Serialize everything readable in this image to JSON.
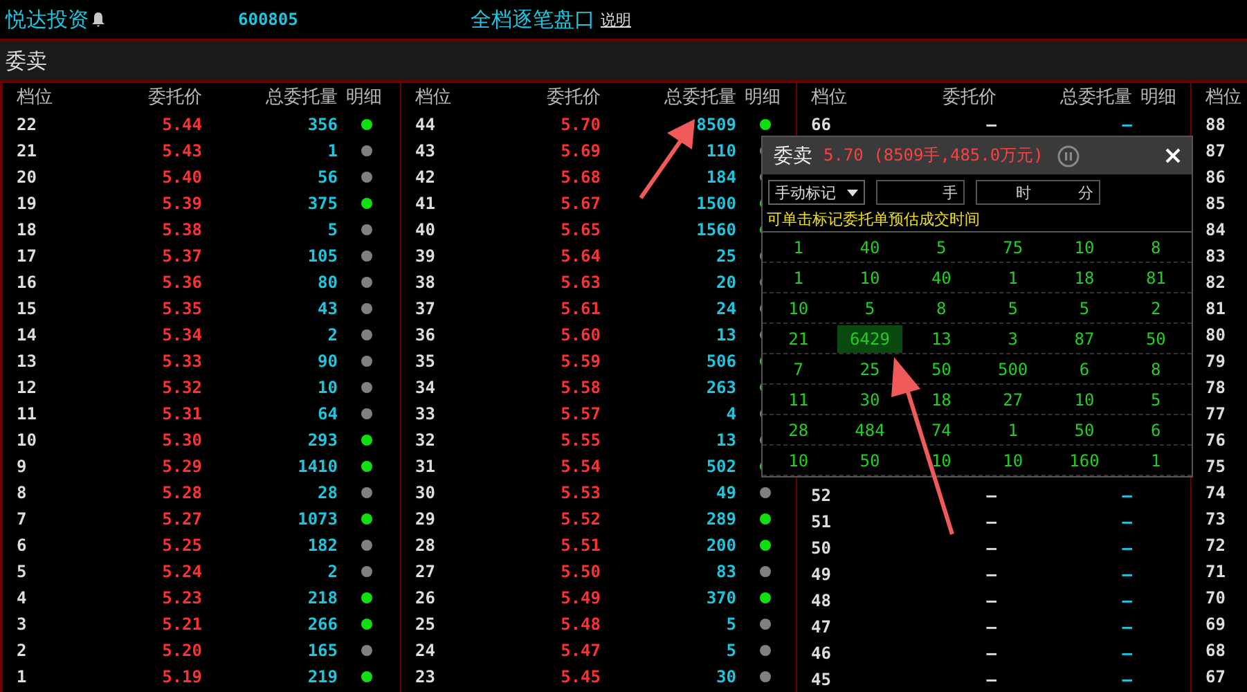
{
  "header": {
    "stock_name": "悦达投资",
    "code": "600805",
    "title": "全档逐笔盘口",
    "help_link": "说明"
  },
  "section_title": "委卖",
  "groups": [
    {
      "columns": [
        "档位",
        "委托价",
        "总委托量",
        "明细"
      ],
      "rows": [
        {
          "tier": "22",
          "price": "5.44",
          "volume": "356",
          "detail": true
        },
        {
          "tier": "21",
          "price": "5.43",
          "volume": "1",
          "detail": false
        },
        {
          "tier": "20",
          "price": "5.40",
          "volume": "56",
          "detail": false
        },
        {
          "tier": "19",
          "price": "5.39",
          "volume": "375",
          "detail": true
        },
        {
          "tier": "18",
          "price": "5.38",
          "volume": "5",
          "detail": false
        },
        {
          "tier": "17",
          "price": "5.37",
          "volume": "105",
          "detail": false
        },
        {
          "tier": "16",
          "price": "5.36",
          "volume": "80",
          "detail": false
        },
        {
          "tier": "15",
          "price": "5.35",
          "volume": "43",
          "detail": false
        },
        {
          "tier": "14",
          "price": "5.34",
          "volume": "2",
          "detail": false
        },
        {
          "tier": "13",
          "price": "5.33",
          "volume": "90",
          "detail": false
        },
        {
          "tier": "12",
          "price": "5.32",
          "volume": "10",
          "detail": false
        },
        {
          "tier": "11",
          "price": "5.31",
          "volume": "64",
          "detail": false
        },
        {
          "tier": "10",
          "price": "5.30",
          "volume": "293",
          "detail": true
        },
        {
          "tier": "9",
          "price": "5.29",
          "volume": "1410",
          "detail": true
        },
        {
          "tier": "8",
          "price": "5.28",
          "volume": "28",
          "detail": false
        },
        {
          "tier": "7",
          "price": "5.27",
          "volume": "1073",
          "detail": true
        },
        {
          "tier": "6",
          "price": "5.25",
          "volume": "182",
          "detail": false
        },
        {
          "tier": "5",
          "price": "5.24",
          "volume": "2",
          "detail": false
        },
        {
          "tier": "4",
          "price": "5.23",
          "volume": "218",
          "detail": true
        },
        {
          "tier": "3",
          "price": "5.21",
          "volume": "266",
          "detail": true
        },
        {
          "tier": "2",
          "price": "5.20",
          "volume": "165",
          "detail": false
        },
        {
          "tier": "1",
          "price": "5.19",
          "volume": "219",
          "detail": true
        }
      ]
    },
    {
      "columns": [
        "档位",
        "委托价",
        "总委托量",
        "明细"
      ],
      "rows": [
        {
          "tier": "44",
          "price": "5.70",
          "volume": "8509",
          "detail": true
        },
        {
          "tier": "43",
          "price": "5.69",
          "volume": "110",
          "detail": false
        },
        {
          "tier": "42",
          "price": "5.68",
          "volume": "184",
          "detail": false
        },
        {
          "tier": "41",
          "price": "5.67",
          "volume": "1500",
          "detail": true
        },
        {
          "tier": "40",
          "price": "5.65",
          "volume": "1560",
          "detail": true
        },
        {
          "tier": "39",
          "price": "5.64",
          "volume": "25",
          "detail": false
        },
        {
          "tier": "38",
          "price": "5.63",
          "volume": "20",
          "detail": false
        },
        {
          "tier": "37",
          "price": "5.61",
          "volume": "24",
          "detail": false
        },
        {
          "tier": "36",
          "price": "5.60",
          "volume": "13",
          "detail": false
        },
        {
          "tier": "35",
          "price": "5.59",
          "volume": "506",
          "detail": true
        },
        {
          "tier": "34",
          "price": "5.58",
          "volume": "263",
          "detail": true
        },
        {
          "tier": "33",
          "price": "5.57",
          "volume": "4",
          "detail": false
        },
        {
          "tier": "32",
          "price": "5.55",
          "volume": "13",
          "detail": false
        },
        {
          "tier": "31",
          "price": "5.54",
          "volume": "502",
          "detail": true
        },
        {
          "tier": "30",
          "price": "5.53",
          "volume": "49",
          "detail": false
        },
        {
          "tier": "29",
          "price": "5.52",
          "volume": "289",
          "detail": true
        },
        {
          "tier": "28",
          "price": "5.51",
          "volume": "200",
          "detail": true
        },
        {
          "tier": "27",
          "price": "5.50",
          "volume": "83",
          "detail": false
        },
        {
          "tier": "26",
          "price": "5.49",
          "volume": "370",
          "detail": true
        },
        {
          "tier": "25",
          "price": "5.48",
          "volume": "5",
          "detail": false
        },
        {
          "tier": "24",
          "price": "5.47",
          "volume": "5",
          "detail": false
        },
        {
          "tier": "23",
          "price": "5.45",
          "volume": "30",
          "detail": false
        }
      ]
    },
    {
      "columns": [
        "档位",
        "委托价",
        "总委托量",
        "明细"
      ],
      "rows": [
        {
          "tier": "66",
          "price": "—",
          "volume": "—"
        },
        {
          "tier": "52",
          "price": "—",
          "volume": "—"
        },
        {
          "tier": "51",
          "price": "—",
          "volume": "—"
        },
        {
          "tier": "50",
          "price": "—",
          "volume": "—"
        },
        {
          "tier": "49",
          "price": "—",
          "volume": "—"
        },
        {
          "tier": "48",
          "price": "—",
          "volume": "—"
        },
        {
          "tier": "47",
          "price": "—",
          "volume": "—"
        },
        {
          "tier": "46",
          "price": "—",
          "volume": "—"
        },
        {
          "tier": "45",
          "price": "—",
          "volume": "—"
        }
      ]
    },
    {
      "columns": [
        "档位"
      ],
      "rows": [
        {
          "tier": "88"
        },
        {
          "tier": "87"
        },
        {
          "tier": "86"
        },
        {
          "tier": "85"
        },
        {
          "tier": "84"
        },
        {
          "tier": "83"
        },
        {
          "tier": "82"
        },
        {
          "tier": "81"
        },
        {
          "tier": "80"
        },
        {
          "tier": "79"
        },
        {
          "tier": "78"
        },
        {
          "tier": "77"
        },
        {
          "tier": "76"
        },
        {
          "tier": "75"
        },
        {
          "tier": "74"
        },
        {
          "tier": "73"
        },
        {
          "tier": "72"
        },
        {
          "tier": "71"
        },
        {
          "tier": "70"
        },
        {
          "tier": "69"
        },
        {
          "tier": "68"
        },
        {
          "tier": "67"
        }
      ]
    }
  ],
  "popup": {
    "title": "委卖",
    "summary": "5.70 (8509手,485.0万元)",
    "mark_select": "手动标记",
    "lots_unit": "手",
    "hour_unit": "时",
    "minute_unit": "分",
    "hint": "可单击标记委托单预估成交时间",
    "grid": [
      [
        {
          "value": "1",
          "selected": false
        },
        {
          "value": "40",
          "selected": false
        },
        {
          "value": "5",
          "selected": false
        },
        {
          "value": "75",
          "selected": false
        },
        {
          "value": "10",
          "selected": false
        },
        {
          "value": "8",
          "selected": false
        }
      ],
      [
        {
          "value": "1",
          "selected": false
        },
        {
          "value": "10",
          "selected": false
        },
        {
          "value": "40",
          "selected": false
        },
        {
          "value": "1",
          "selected": false
        },
        {
          "value": "18",
          "selected": false
        },
        {
          "value": "81",
          "selected": false
        }
      ],
      [
        {
          "value": "10",
          "selected": false
        },
        {
          "value": "5",
          "selected": false
        },
        {
          "value": "8",
          "selected": false
        },
        {
          "value": "5",
          "selected": false
        },
        {
          "value": "5",
          "selected": false
        },
        {
          "value": "2",
          "selected": false
        }
      ],
      [
        {
          "value": "21",
          "selected": false
        },
        {
          "value": "6429",
          "selected": true
        },
        {
          "value": "13",
          "selected": false
        },
        {
          "value": "3",
          "selected": false
        },
        {
          "value": "87",
          "selected": false
        },
        {
          "value": "50",
          "selected": false
        }
      ],
      [
        {
          "value": "7",
          "selected": false
        },
        {
          "value": "25",
          "selected": false
        },
        {
          "value": "50",
          "selected": false
        },
        {
          "value": "500",
          "selected": false
        },
        {
          "value": "6",
          "selected": false
        },
        {
          "value": "8",
          "selected": false
        }
      ],
      [
        {
          "value": "11",
          "selected": false
        },
        {
          "value": "30",
          "selected": false
        },
        {
          "value": "18",
          "selected": false
        },
        {
          "value": "27",
          "selected": false
        },
        {
          "value": "10",
          "selected": false
        },
        {
          "value": "5",
          "selected": false
        }
      ],
      [
        {
          "value": "28",
          "selected": false
        },
        {
          "value": "484",
          "selected": false
        },
        {
          "value": "74",
          "selected": false
        },
        {
          "value": "1",
          "selected": false
        },
        {
          "value": "50",
          "selected": false
        },
        {
          "value": "6",
          "selected": false
        }
      ],
      [
        {
          "value": "10",
          "selected": false
        },
        {
          "value": "50",
          "selected": false
        },
        {
          "value": "10",
          "selected": false
        },
        {
          "value": "10",
          "selected": false
        },
        {
          "value": "160",
          "selected": false
        },
        {
          "value": "1",
          "selected": false
        }
      ]
    ]
  }
}
